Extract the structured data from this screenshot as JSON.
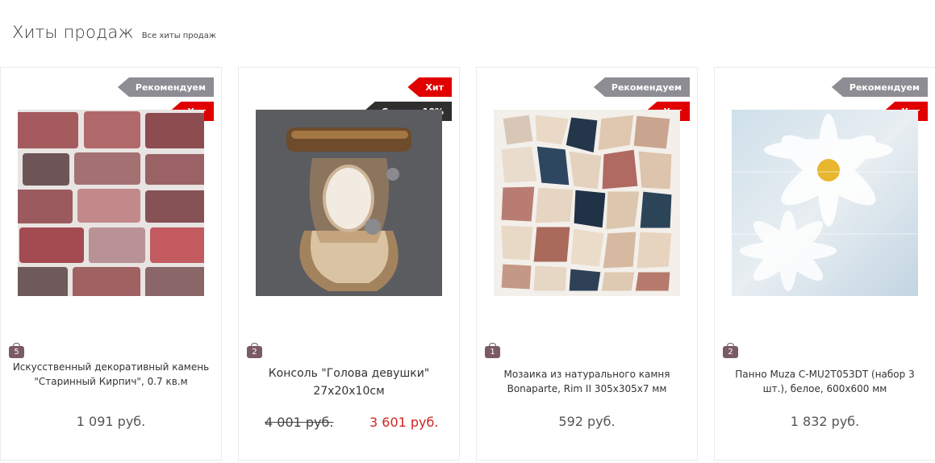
{
  "section": {
    "title": "Хиты продаж",
    "all_link": "Все хиты продаж"
  },
  "products": [
    {
      "tags": [
        "Рекомендуем",
        "Хит"
      ],
      "count": "5",
      "name": "Искусственный декоративный камень \"Старинный Кирпич\", 0.7 кв.м",
      "price": "1 091 руб."
    },
    {
      "tags": [
        "Хит",
        "Скидка 10%"
      ],
      "count": "2",
      "name": "Консоль \"Голова девушки\" 27x20x10см",
      "old_price": "4 001 руб.",
      "price": "3 601 руб."
    },
    {
      "tags": [
        "Рекомендуем",
        "Хит"
      ],
      "count": "1",
      "name": "Мозаика из натурального камня Bonaparte, Rim II 305x305x7 мм",
      "price": "592 руб."
    },
    {
      "tags": [
        "Рекомендуем",
        "Хит"
      ],
      "count": "2",
      "name": "Панно Muza C-MU2T053DT (набор 3 шт.), белое, 600x600 мм",
      "price": "1 832 руб."
    }
  ],
  "colors": {
    "tag_recommend": "#8d8d93",
    "tag_hit": "#e10000",
    "tag_discount": "#2f2f2f",
    "sale_price": "#d22323",
    "count_badge": "#7a5a66"
  }
}
